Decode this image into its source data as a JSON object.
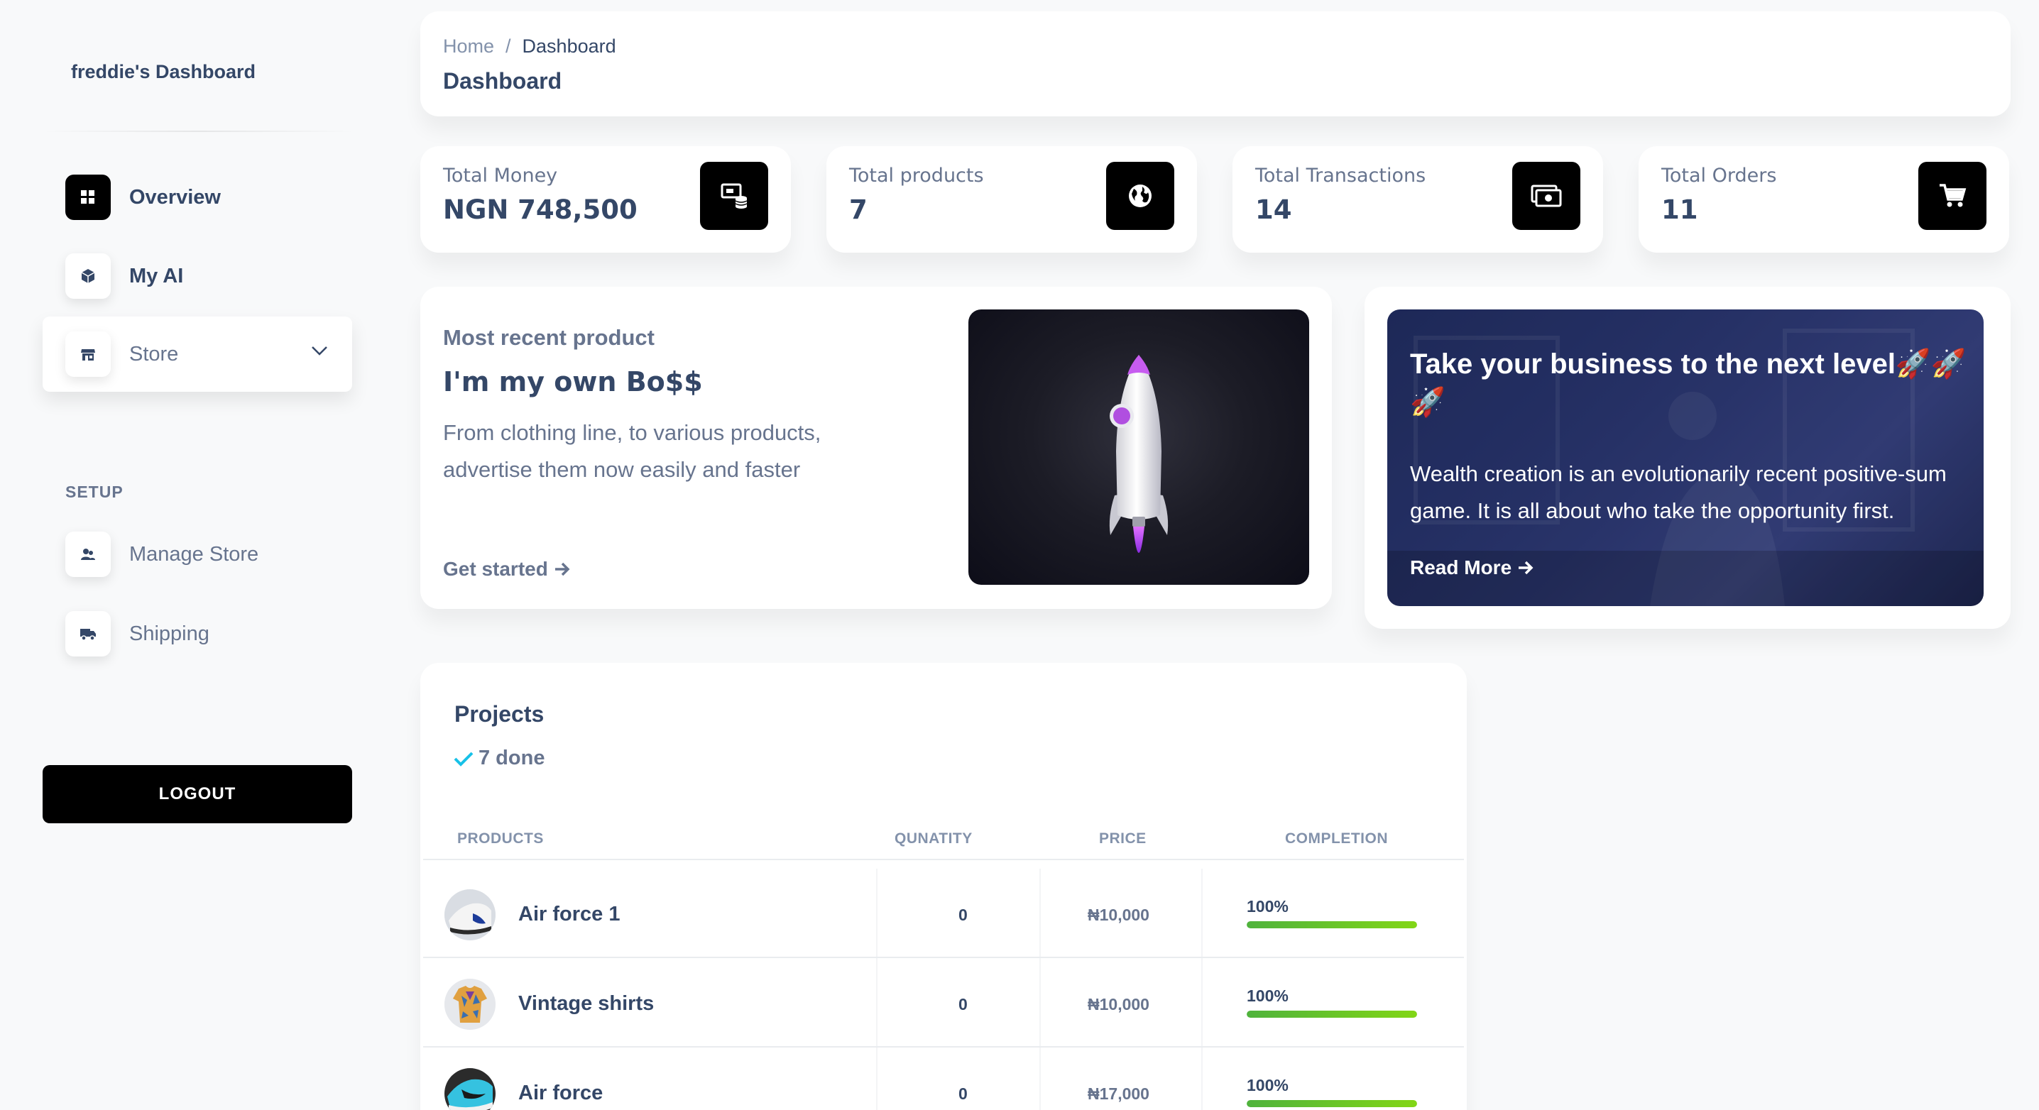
{
  "sidebar": {
    "brand": "freddie's Dashboard",
    "items": [
      {
        "label": "Overview",
        "icon": "grid-icon"
      },
      {
        "label": "My AI",
        "icon": "cube-icon"
      },
      {
        "label": "Store",
        "icon": "shop-icon"
      }
    ],
    "setup_title": "SETUP",
    "setup_items": [
      {
        "label": "Manage Store",
        "icon": "users-icon"
      },
      {
        "label": "Shipping",
        "icon": "truck-icon"
      }
    ],
    "logout_label": "LOGOUT"
  },
  "header": {
    "breadcrumb_home": "Home",
    "breadcrumb_sep": "/",
    "breadcrumb_current": "Dashboard",
    "title": "Dashboard"
  },
  "stats": [
    {
      "label": "Total Money",
      "value": "NGN 748,500",
      "icon": "money-stack-icon"
    },
    {
      "label": "Total products",
      "value": "7",
      "icon": "globe-icon"
    },
    {
      "label": "Total Transactions",
      "value": "14",
      "icon": "cash-icon"
    },
    {
      "label": "Total Orders",
      "value": "11",
      "icon": "cart-icon"
    }
  ],
  "recent": {
    "label": "Most recent product",
    "title": "I'm my own Bo$$",
    "desc": "From clothing line, to various products, advertise them now easily and faster",
    "link": "Get started"
  },
  "promo": {
    "title": "Take your business to the next level🚀🚀🚀",
    "desc": "Wealth creation is an evolutionarily recent positive-sum game. It is all about who take the opportunity first.",
    "link": "Read More"
  },
  "projects": {
    "title": "Projects",
    "done": "7 done",
    "columns": [
      "PRODUCTS",
      "QUNATITY",
      "PRICE",
      "COMPLETION"
    ],
    "rows": [
      {
        "name": "Air force 1",
        "quantity": "0",
        "price": "₦10,000",
        "completion": "100%",
        "progress": 1.0
      },
      {
        "name": "Vintage shirts",
        "quantity": "0",
        "price": "₦10,000",
        "completion": "100%",
        "progress": 1.0
      },
      {
        "name": "Air force",
        "quantity": "0",
        "price": "₦17,000",
        "completion": "100%",
        "progress": 1.0
      }
    ]
  },
  "colors": {
    "accent_dark": "#000000",
    "text_primary": "#344767",
    "text_secondary": "#67748e",
    "progress_green": "#82d616",
    "check_blue": "#17c1e8",
    "promo_bg": "#2d3a78"
  }
}
